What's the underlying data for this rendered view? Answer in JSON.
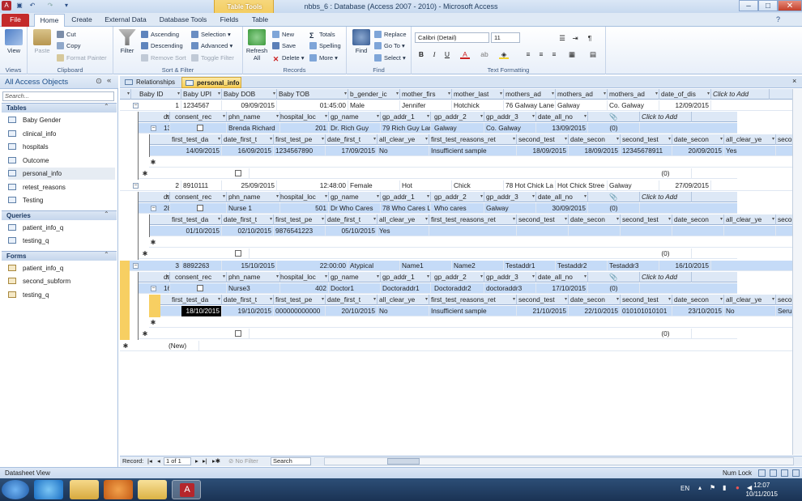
{
  "window": {
    "title": "nbbs_6 : Database (Access 2007 - 2010)  -  Microsoft Access",
    "contextual_tab": "Table Tools"
  },
  "ribbon_tabs": [
    "File",
    "Home",
    "Create",
    "External Data",
    "Database Tools",
    "Fields",
    "Table"
  ],
  "ribbon": {
    "views": {
      "view": "View",
      "label": "Views"
    },
    "clipboard": {
      "paste": "Paste",
      "cut": "Cut",
      "copy": "Copy",
      "format_painter": "Format Painter",
      "label": "Clipboard"
    },
    "sort_filter": {
      "filter": "Filter",
      "ascending": "Ascending",
      "descending": "Descending",
      "remove_sort": "Remove Sort",
      "selection": "Selection",
      "advanced": "Advanced",
      "toggle_filter": "Toggle Filter",
      "label": "Sort & Filter"
    },
    "records": {
      "refresh": "Refresh All",
      "new": "New",
      "save": "Save",
      "delete": "Delete",
      "totals": "Totals",
      "spelling": "Spelling",
      "more": "More",
      "label": "Records"
    },
    "find": {
      "find": "Find",
      "replace": "Replace",
      "goto": "Go To",
      "select": "Select",
      "label": "Find"
    },
    "text_formatting": {
      "font": "Calibri (Detail)",
      "size": "11",
      "label": "Text Formatting"
    }
  },
  "nav": {
    "header": "All Access Objects",
    "search_placeholder": "Search...",
    "sections": [
      {
        "title": "Tables",
        "items": [
          "Baby Gender",
          "clinical_info",
          "hospitals",
          "Outcome",
          "personal_info",
          "retest_reasons",
          "Testing"
        ]
      },
      {
        "title": "Queries",
        "items": [
          "patient_info_q",
          "testing_q"
        ]
      },
      {
        "title": "Forms",
        "items": [
          "patient_info_q",
          "second_subform",
          "testing_q"
        ]
      }
    ]
  },
  "doc_tabs": [
    "Relationships",
    "personal_info"
  ],
  "main_headers": [
    "Baby ID",
    "Baby UPI",
    "Baby DOB",
    "Baby TOB",
    "b_gender_ic",
    "mother_firs",
    "mother_last",
    "mothers_ad",
    "mothers_ad",
    "mothers_ad",
    "date_of_dis",
    "Click to Add"
  ],
  "main_rows": [
    [
      "1",
      "1234567",
      "09/09/2015",
      "01:45:00",
      "Male",
      "Jennifer",
      "Hotchick",
      "76 Galway Lane",
      "Galway",
      "Co. Galway",
      "12/09/2015"
    ],
    [
      "2",
      "8910111",
      "25/09/2015",
      "12:48:00",
      "Female",
      "Hot",
      "Chick",
      "78 Hot Chick La",
      "Hot Chick Stree",
      "Galway",
      "27/09/2015"
    ],
    [
      "3",
      "8892263",
      "15/10/2015",
      "22:00:00",
      "Atypical",
      "Name1",
      "Name2",
      "Testaddr1",
      "Testaddr2",
      "Testaddr3",
      "16/10/2015"
    ]
  ],
  "sub_headers": [
    "date_tranf_",
    "consent_rec",
    "phn_name",
    "hospital_loc",
    "gp_name",
    "gp_addr_1",
    "gp_addr_2",
    "gp_addr_3",
    "date_all_no",
    "",
    "Click to Add"
  ],
  "sub_rows": [
    [
      "13/09/2015",
      "",
      "Brenda Richard",
      "201",
      "Dr. Rich Guy",
      "79 Rich Guy Lan",
      "Galway",
      "Co. Galway",
      "13/09/2015",
      "(0)"
    ],
    [
      "28/09/2015",
      "",
      "Nurse 1",
      "501",
      "Dr Who Cares",
      "78 Who Cares L",
      "Who cares",
      "Galway",
      "30/09/2015",
      "(0)"
    ],
    [
      "16/10/2015",
      "",
      "Nurse3",
      "402",
      "Doctor1",
      "Doctoraddr1",
      "Doctoraddr2",
      "doctoraddr3",
      "17/10/2015",
      "(0)"
    ]
  ],
  "sub_new_attachment": "(0)",
  "sub2_headers": [
    "first_test_da",
    "date_first_t",
    "first_test_pe",
    "date_first_t",
    "all_clear_ye",
    "first_test_reasons_ret",
    "second_test",
    "date_secon",
    "second_test",
    "date_secon",
    "all_clear_ye",
    "secon"
  ],
  "sub2_rows": [
    [
      "14/09/2015",
      "16/09/2015",
      "1234567890",
      "17/09/2015",
      "No",
      "Insufficient sample",
      "18/09/2015",
      "18/09/2015",
      "12345678911",
      "20/09/2015",
      "Yes",
      ""
    ],
    [
      "01/10/2015",
      "02/10/2015",
      "9876541223",
      "05/10/2015",
      "Yes",
      "",
      "",
      "",
      "",
      "",
      "",
      ""
    ],
    [
      "18/10/2015",
      "19/10/2015",
      "000000000000",
      "20/10/2015",
      "No",
      "Insufficient sample",
      "21/10/2015",
      "22/10/2015",
      "010101010101",
      "23/10/2015",
      "No",
      "Serum"
    ]
  ],
  "new_row_label": "(New)",
  "record_nav": {
    "label": "Record:",
    "position": "1 of 1",
    "filter": "No Filter",
    "search": "Search"
  },
  "status": {
    "left": "Datasheet View",
    "num_lock": "Num Lock"
  },
  "taskbar": {
    "lang": "EN",
    "time": "12:07",
    "date": "10/11/2015"
  }
}
